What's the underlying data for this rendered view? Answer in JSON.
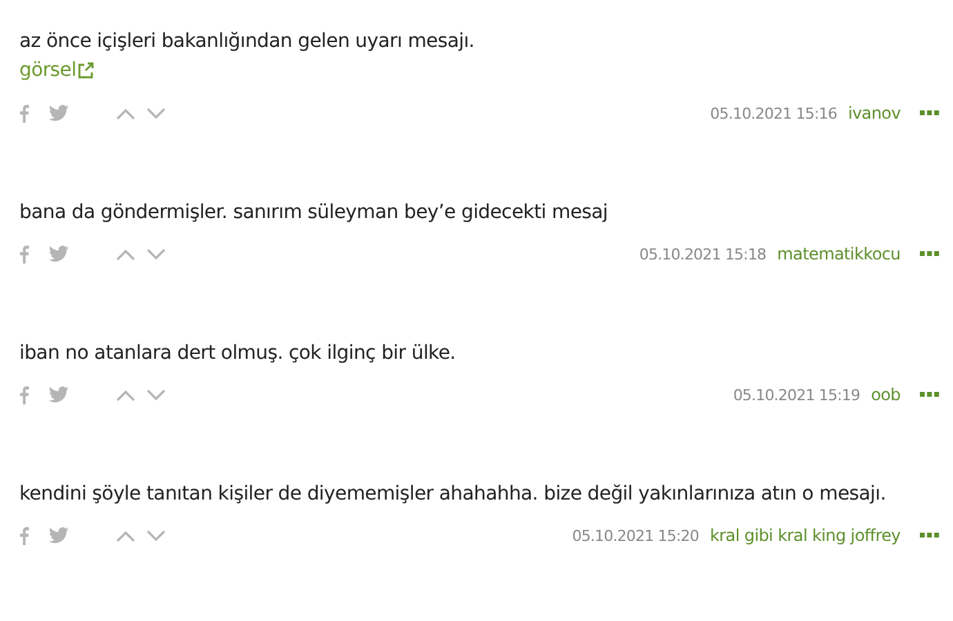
{
  "entries": [
    {
      "text": "az önce içişleri bakanlığından gelen uyarı mesajı.",
      "link": "görsel",
      "date": "05.10.2021 15:16",
      "author": "ivanov"
    },
    {
      "text": "bana da göndermişler. sanırım süleyman bey’e gidecekti mesaj",
      "date": "05.10.2021 15:18",
      "author": "matematikkocu"
    },
    {
      "text": "iban no atanlara dert olmuş. çok ilginç bir ülke.",
      "date": "05.10.2021 15:19",
      "author": "oob"
    },
    {
      "text": "kendini şöyle tanıtan kişiler de diyememişler ahahahha. bize değil yakınlarınıza atın o mesajı.",
      "date": "05.10.2021 15:20",
      "author": "kral gibi kral king joffrey"
    }
  ]
}
